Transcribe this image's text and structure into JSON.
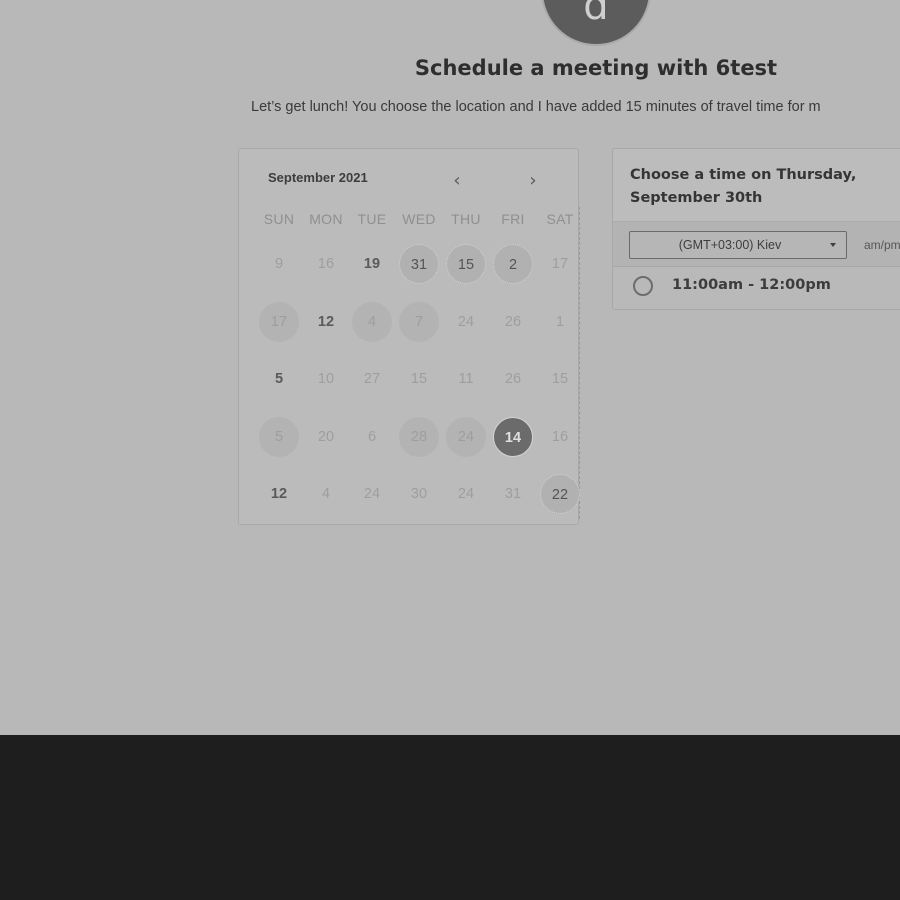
{
  "header": {
    "avatar_letter": "d",
    "title": "Schedule a meeting with 6test",
    "description": "Let’s get lunch! You choose the location and I have added 15 minutes of travel time for m"
  },
  "calendar": {
    "month_label": "September 2021",
    "prev_icon": "chevron-left-icon",
    "next_icon": "chevron-right-icon",
    "prev_glyph": "‹",
    "next_glyph": "›",
    "weekdays": [
      "SUN",
      "MON",
      "TUE",
      "WED",
      "THU",
      "FRI",
      "SAT"
    ],
    "weeks": [
      [
        {
          "text": "9"
        },
        {
          "text": "16"
        },
        {
          "text": "19",
          "style": "bold"
        },
        {
          "text": "31",
          "style": "dot"
        },
        {
          "text": "15",
          "style": "dot"
        },
        {
          "text": "2",
          "style": "dot"
        },
        {
          "text": "17"
        }
      ],
      [
        {
          "text": "17",
          "style": "bg"
        },
        {
          "text": "12",
          "style": "bold"
        },
        {
          "text": "4",
          "style": "bg"
        },
        {
          "text": "7",
          "style": "bg"
        },
        {
          "text": "24"
        },
        {
          "text": "26"
        },
        {
          "text": "1"
        }
      ],
      [
        {
          "text": "5",
          "style": "bold"
        },
        {
          "text": "10"
        },
        {
          "text": "27"
        },
        {
          "text": "15"
        },
        {
          "text": "11"
        },
        {
          "text": "26"
        },
        {
          "text": "15"
        }
      ],
      [
        {
          "text": "5",
          "style": "bg"
        },
        {
          "text": "20"
        },
        {
          "text": "6"
        },
        {
          "text": "28",
          "style": "bg"
        },
        {
          "text": "24",
          "style": "bg"
        },
        {
          "text": "14",
          "style": "sel"
        },
        {
          "text": "16"
        }
      ],
      [
        {
          "text": "12",
          "style": "bold"
        },
        {
          "text": "4"
        },
        {
          "text": "24"
        },
        {
          "text": "30"
        },
        {
          "text": "24"
        },
        {
          "text": "31"
        },
        {
          "text": "22",
          "style": "dot"
        }
      ]
    ]
  },
  "time_panel": {
    "title": "Choose a time on Thursday, September 30th",
    "timezone": "(GMT+03:00) Kiev",
    "ampm_label": "am/pm",
    "slots": [
      "11:00am - 12:00pm"
    ]
  },
  "colors": {
    "page_bg": "#b8b8b8",
    "footer_bg": "#1e1e1e",
    "selected_day": "#6b6b6b"
  }
}
